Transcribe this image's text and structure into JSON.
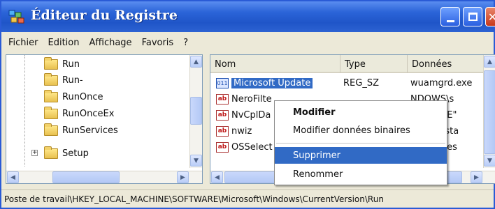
{
  "window": {
    "title": "Éditeur du Registre"
  },
  "menu": [
    "Fichier",
    "Edition",
    "Affichage",
    "Favoris",
    "?"
  ],
  "tree": {
    "items": [
      {
        "label": "Run"
      },
      {
        "label": "Run-"
      },
      {
        "label": "RunOnce"
      },
      {
        "label": "RunOnceEx"
      },
      {
        "label": "RunServices"
      },
      {
        "label": "Setup",
        "expander": "+"
      }
    ]
  },
  "list": {
    "columns": [
      "Nom",
      "Type",
      "Données"
    ],
    "rows": [
      {
        "icon": "binary-value-icon",
        "name": "Microsoft Update",
        "type": "REG_SZ",
        "data": "wuamgrd.exe",
        "selected": true
      },
      {
        "icon": "string-value-icon",
        "name": "NeroFilte",
        "type": "",
        "data": "NDOWS\\s"
      },
      {
        "icon": "string-value-icon",
        "name": "NvCplDa",
        "type": "",
        "data": "LL32.EXE\""
      },
      {
        "icon": "string-value-icon",
        "name": "nwiz",
        "type": "",
        "data": "exe\" /insta"
      },
      {
        "icon": "string-value-icon",
        "name": "OSSelect",
        "type": "",
        "data": "gram Files"
      }
    ]
  },
  "context_menu": {
    "items": [
      {
        "label": "Modifier",
        "bold": true
      },
      {
        "label": "Modifier données binaires"
      },
      {
        "label": "Supprimer",
        "highlighted": true
      },
      {
        "label": "Renommer"
      }
    ]
  },
  "status": {
    "path": "Poste de travail\\HKEY_LOCAL_MACHINE\\SOFTWARE\\Microsoft\\Windows\\CurrentVersion\\Run"
  },
  "colors": {
    "titlebar": "#2b64d8",
    "selection": "#316ac5",
    "close_button": "#c7381b"
  }
}
